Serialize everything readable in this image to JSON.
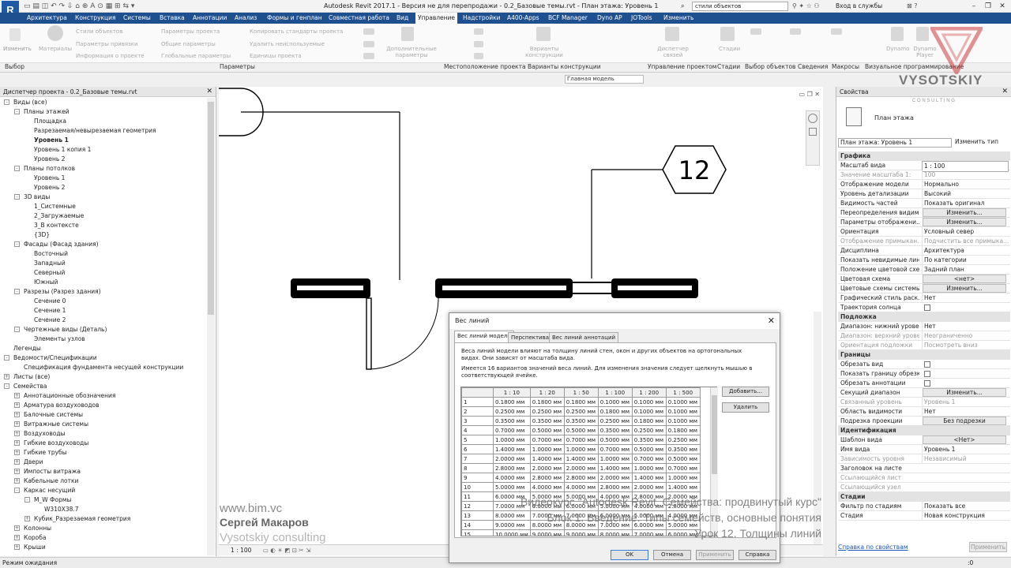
{
  "window": {
    "title": "Autodesk Revit 2017.1 - Версия не для перепродажи -     0.2_Базовые темы.rvt - План этажа: Уровень 1",
    "search_value": "стили объектов",
    "signin": "Вход в службы"
  },
  "app_logo": "R",
  "menu_tabs": [
    "Архитектура",
    "Конструкция",
    "Системы",
    "Вставка",
    "Аннотации",
    "Анализ",
    "Формы и генплан",
    "Совместная работа",
    "Вид",
    "Управление",
    "Надстройки",
    "A400-Apps",
    "BCF Manager",
    "Dyno AP",
    "JOTools",
    "Изменить"
  ],
  "active_tab": "Управление",
  "ribbon": {
    "modify": "Изменить",
    "materials": "Материалы",
    "object_styles": "Стили объектов",
    "snaps": "Параметры привязки",
    "project_info": "Информация о проекте",
    "project_params": "Параметры проекта",
    "shared_params": "Общие параметры",
    "global_params": "Глобальные параметры",
    "transfer_standards": "Копировать стандарты проекта",
    "purge": "Удалить неиспользуемые",
    "units": "Единицы проекта",
    "additional": "Дополнительные параметры",
    "design_options": "Варианты конструкции",
    "main_model": "Главная модель",
    "phases_manager": "Диспетчер связей",
    "phases": "Стадии",
    "dynamo": "Dynamo",
    "dynamo_player": "Dynamo Player",
    "groups": {
      "select": "Выбор",
      "params": "Параметры",
      "location": "Местоположение проекта",
      "options": "Варианты конструкции",
      "manage_project": "Управление проектом",
      "phasing": "Стадии",
      "selection": "Выбор объектов",
      "inquiry": "Сведения",
      "macros": "Макросы",
      "visual_prog": "Визуальное программирование"
    }
  },
  "browser": {
    "title": "Диспетчер проекта - 0.2_Базовые темы.rvt",
    "items": [
      {
        "t": "Виды (все)",
        "lvl": 0,
        "exp": "-"
      },
      {
        "t": "Планы этажей",
        "lvl": 1,
        "exp": "-"
      },
      {
        "t": "Площадка",
        "lvl": 2
      },
      {
        "t": "Разрезаемая/невырезаемая геометрия",
        "lvl": 2
      },
      {
        "t": "Уровень 1",
        "lvl": 2,
        "bold": true
      },
      {
        "t": "Уровень 1 копия 1",
        "lvl": 2
      },
      {
        "t": "Уровень 2",
        "lvl": 2
      },
      {
        "t": "Планы потолков",
        "lvl": 1,
        "exp": "-"
      },
      {
        "t": "Уровень 1",
        "lvl": 2
      },
      {
        "t": "Уровень 2",
        "lvl": 2
      },
      {
        "t": "3D виды",
        "lvl": 1,
        "exp": "-"
      },
      {
        "t": "1_Системные",
        "lvl": 2
      },
      {
        "t": "2_Загружаемые",
        "lvl": 2
      },
      {
        "t": "3_В контексте",
        "lvl": 2
      },
      {
        "t": "{3D}",
        "lvl": 2
      },
      {
        "t": "Фасады (Фасад здания)",
        "lvl": 1,
        "exp": "-"
      },
      {
        "t": "Восточный",
        "lvl": 2
      },
      {
        "t": "Западный",
        "lvl": 2
      },
      {
        "t": "Северный",
        "lvl": 2
      },
      {
        "t": "Южный",
        "lvl": 2
      },
      {
        "t": "Разрезы (Разрез здания)",
        "lvl": 1,
        "exp": "-"
      },
      {
        "t": "Сечение 0",
        "lvl": 2
      },
      {
        "t": "Сечение 1",
        "lvl": 2
      },
      {
        "t": "Сечение 2",
        "lvl": 2
      },
      {
        "t": "Чертежные виды (Деталь)",
        "lvl": 1,
        "exp": "-"
      },
      {
        "t": "Элементы узлов",
        "lvl": 2
      },
      {
        "t": "Легенды",
        "lvl": 0
      },
      {
        "t": "Ведомости/Спецификации",
        "lvl": 0,
        "exp": "-"
      },
      {
        "t": "Спецификация фундамента несущей конструкции",
        "lvl": 1
      },
      {
        "t": "Листы (все)",
        "lvl": 0,
        "exp": "+"
      },
      {
        "t": "Семейства",
        "lvl": 0,
        "exp": "-"
      },
      {
        "t": "Аннотационные обозначения",
        "lvl": 1,
        "exp": "+"
      },
      {
        "t": "Арматура воздуховодов",
        "lvl": 1,
        "exp": "+"
      },
      {
        "t": "Балочные системы",
        "lvl": 1,
        "exp": "+"
      },
      {
        "t": "Витражные системы",
        "lvl": 1,
        "exp": "+"
      },
      {
        "t": "Воздуховоды",
        "lvl": 1,
        "exp": "+"
      },
      {
        "t": "Гибкие воздуховоды",
        "lvl": 1,
        "exp": "+"
      },
      {
        "t": "Гибкие трубы",
        "lvl": 1,
        "exp": "+"
      },
      {
        "t": "Двери",
        "lvl": 1,
        "exp": "+"
      },
      {
        "t": "Импосты витража",
        "lvl": 1,
        "exp": "+"
      },
      {
        "t": "Кабельные лотки",
        "lvl": 1,
        "exp": "+"
      },
      {
        "t": "Каркас несущий",
        "lvl": 1,
        "exp": "-"
      },
      {
        "t": "M_W Формы",
        "lvl": 2,
        "exp": "-"
      },
      {
        "t": "W310X38.7",
        "lvl": 3
      },
      {
        "t": "Кубик_Разрезаемая геометрия",
        "lvl": 2,
        "exp": "+"
      },
      {
        "t": "Колонны",
        "lvl": 1,
        "exp": "+"
      },
      {
        "t": "Короба",
        "lvl": 1,
        "exp": "+"
      },
      {
        "t": "Крыши",
        "lvl": 1,
        "exp": "+"
      }
    ]
  },
  "canvas": {
    "tag": "12",
    "scale": "1 : 100"
  },
  "properties": {
    "title": "Свойства",
    "type_name": "План этажа",
    "selector": "План этажа: Уровень 1",
    "edit_type": "Изменить тип",
    "rows": [
      {
        "g": "Графика"
      },
      {
        "k": "Масштаб вида",
        "v": "1 : 100",
        "input": true
      },
      {
        "k": "Значение масштаба   1:",
        "v": "100",
        "dis": true
      },
      {
        "k": "Отображение модели",
        "v": "Нормально"
      },
      {
        "k": "Уровень детализации",
        "v": "Высокий"
      },
      {
        "k": "Видимость частей",
        "v": "Показать оригинал"
      },
      {
        "k": "Переопределения видим...",
        "b": "Изменить..."
      },
      {
        "k": "Параметры отображени...",
        "b": "Изменить..."
      },
      {
        "k": "Ориентация",
        "v": "Условный север"
      },
      {
        "k": "Отображение примыкан...",
        "v": "Подчистить все примыка...",
        "dis": true
      },
      {
        "k": "Дисциплина",
        "v": "Архитектура"
      },
      {
        "k": "Показать невидимые лин...",
        "v": "По категории"
      },
      {
        "k": "Положение цветовой схе...",
        "v": "Задний план"
      },
      {
        "k": "Цветовая схема",
        "b": "<нет>"
      },
      {
        "k": "Цветовые схемы системы",
        "b": "Изменить..."
      },
      {
        "k": "Графический стиль раск...",
        "v": "Нет"
      },
      {
        "k": "Траектория солнца",
        "c": true
      },
      {
        "g": "Подложка"
      },
      {
        "k": "Диапазон: нижний урове...",
        "v": "Нет"
      },
      {
        "k": "Диапазон: верхний урове...",
        "v": "Неограниченно",
        "dis": true
      },
      {
        "k": "Ориентация подложки",
        "v": "Посмотреть вниз",
        "dis": true
      },
      {
        "g": "Границы"
      },
      {
        "k": "Обрезать вид",
        "c": true
      },
      {
        "k": "Показать границу обрезки",
        "c": true
      },
      {
        "k": "Обрезать аннотации",
        "c": true
      },
      {
        "k": "Секущий диапазон",
        "b": "Изменить..."
      },
      {
        "k": "Связанный уровень",
        "v": "Уровень 1",
        "dis": true
      },
      {
        "k": "Область видимости",
        "v": "Нет"
      },
      {
        "k": "Подрезка проекции",
        "b": "Без подрезки"
      },
      {
        "g": "Идентификация"
      },
      {
        "k": "Шаблон вида",
        "b": "<Нет>"
      },
      {
        "k": "Имя вида",
        "v": "Уровень 1"
      },
      {
        "k": "Зависимость уровня",
        "v": "Независимый",
        "dis": true
      },
      {
        "k": "Заголовок на листе",
        "v": ""
      },
      {
        "k": "Ссылающийся лист",
        "v": "",
        "dis": true
      },
      {
        "k": "Ссылающийся узел",
        "v": "",
        "dis": true
      },
      {
        "g": "Стадии"
      },
      {
        "k": "Фильтр по стадиям",
        "v": "Показать все"
      },
      {
        "k": "Стадия",
        "v": "Новая конструкция"
      }
    ],
    "help": "Справка по свойствам",
    "apply": "Применить"
  },
  "status": {
    "text": "Режим ожидания",
    "zero": ":0"
  },
  "dialog": {
    "title": "Вес линий",
    "tabs": [
      "Вес линий модели",
      "Перспектива",
      "Вес линий аннотаций"
    ],
    "desc1": "Веса линий модели влияют на толщину линий стен, окон и других объектов на ортогональных видах. Они зависят от масштаба вида.",
    "desc2": "Имеется 16 вариантов значений веса линий. Для изменения значения следует щелкнуть мышью в соответствующей ячейке.",
    "columns": [
      "",
      "1 : 10",
      "1 : 20",
      "1 : 50",
      "1 : 100",
      "1 : 200",
      "1 : 500"
    ],
    "rows": [
      [
        "1",
        "0.1800 мм",
        "0.1800 мм",
        "0.1800 мм",
        "0.1000 мм",
        "0.1000 мм",
        "0.1000 мм"
      ],
      [
        "2",
        "0.2500 мм",
        "0.2500 мм",
        "0.2500 мм",
        "0.1800 мм",
        "0.1000 мм",
        "0.1000 мм"
      ],
      [
        "3",
        "0.3500 мм",
        "0.3500 мм",
        "0.3500 мм",
        "0.2500 мм",
        "0.1800 мм",
        "0.1000 мм"
      ],
      [
        "4",
        "0.7000 мм",
        "0.5000 мм",
        "0.5000 мм",
        "0.3500 мм",
        "0.2500 мм",
        "0.1800 мм"
      ],
      [
        "5",
        "1.0000 мм",
        "0.7000 мм",
        "0.7000 мм",
        "0.5000 мм",
        "0.3500 мм",
        "0.2500 мм"
      ],
      [
        "6",
        "1.4000 мм",
        "1.0000 мм",
        "1.0000 мм",
        "0.7000 мм",
        "0.5000 мм",
        "0.3500 мм"
      ],
      [
        "7",
        "2.0000 мм",
        "1.4000 мм",
        "1.4000 мм",
        "1.0000 мм",
        "0.7000 мм",
        "0.5000 мм"
      ],
      [
        "8",
        "2.8000 мм",
        "2.0000 мм",
        "2.0000 мм",
        "1.4000 мм",
        "1.0000 мм",
        "0.7000 мм"
      ],
      [
        "9",
        "4.0000 мм",
        "2.8000 мм",
        "2.8000 мм",
        "2.0000 мм",
        "1.4000 мм",
        "1.0000 мм"
      ],
      [
        "10",
        "5.0000 мм",
        "4.0000 мм",
        "4.0000 мм",
        "2.8000 мм",
        "2.0000 мм",
        "1.4000 мм"
      ],
      [
        "11",
        "6.0000 мм",
        "5.0000 мм",
        "5.0000 мм",
        "4.0000 мм",
        "2.8000 мм",
        "2.0000 мм"
      ],
      [
        "12",
        "7.0000 мм",
        "6.0000 мм",
        "6.0000 мм",
        "5.0000 мм",
        "4.0000 мм",
        "2.8000 мм"
      ],
      [
        "13",
        "8.0000 мм",
        "7.0000 мм",
        "7.0000 мм",
        "6.0000 мм",
        "5.0000 мм",
        "4.0000 мм"
      ],
      [
        "14",
        "9.0000 мм",
        "8.0000 мм",
        "8.0000 мм",
        "7.0000 мм",
        "6.0000 мм",
        "5.0000 мм"
      ],
      [
        "15",
        "10.0000 мм",
        "9.0000 мм",
        "9.0000 мм",
        "8.0000 мм",
        "7.0000 мм",
        "6.0000 мм"
      ]
    ],
    "add": "Добавить...",
    "remove": "Удалить",
    "ok": "OK",
    "cancel": "Отмена",
    "apply": "Применить",
    "help": "Справка"
  },
  "watermark": {
    "site": "www.bim.vc",
    "author": "Сергей Макаров",
    "company": "Vysotskiy consulting",
    "course": "Видеокурс \"Autodesk Revit. Семейства: продвинутый курс\"",
    "block": "Блок 1. Введение. Типы семейств, основные понятия",
    "lesson": "Урок 12. Толщины линий",
    "logo_text": "VYSOTSKIY",
    "logo_sub": "C O N S U L T I N G"
  },
  "colors": {
    "menu_bg": "#1e4f8f",
    "accent": "#1f5aa8"
  }
}
